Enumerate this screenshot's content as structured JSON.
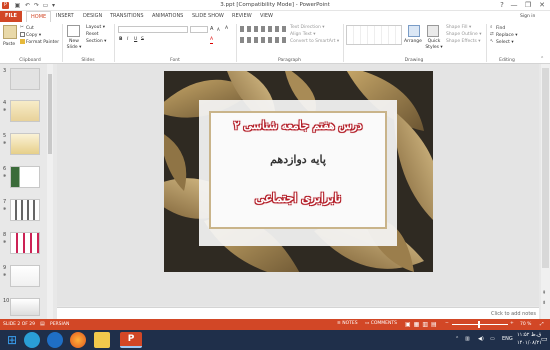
{
  "window": {
    "title": "3.ppt [Compatibility Mode] - PowerPoint",
    "help": "?",
    "minimize": "—",
    "restore": "❐",
    "close": "✕"
  },
  "tabs": [
    "FILE",
    "HOME",
    "INSERT",
    "DESIGN",
    "TRANSITIONS",
    "ANIMATIONS",
    "SLIDE SHOW",
    "REVIEW",
    "VIEW"
  ],
  "account": "Sign in",
  "ribbon": {
    "clipboard": {
      "paste": "Paste",
      "cut": "Cut",
      "copy": "Copy ▾",
      "format_painter": "Format Painter",
      "label": "Clipboard"
    },
    "slides": {
      "new_slide": "New Slide ▾",
      "layout": "Layout ▾",
      "reset": "Reset",
      "section": "Section ▾",
      "label": "Slides"
    },
    "font": {
      "label": "Font",
      "bold": "B",
      "italic": "I",
      "underline": "U",
      "strike": "S",
      "grow": "A",
      "shrink": "A",
      "clear": "A",
      "color": "A"
    },
    "paragraph": {
      "text_direction": "Text Direction ▾",
      "align_text": "Align Text ▾",
      "convert_smartart": "Convert to SmartArt ▾",
      "label": "Paragraph"
    },
    "drawing": {
      "arrange": "Arrange",
      "quick_styles": "Quick Styles ▾",
      "shape_fill": "Shape Fill ▾",
      "shape_outline": "Shape Outline ▾",
      "shape_effects": "Shape Effects ▾",
      "label": "Drawing"
    },
    "editing": {
      "find": "Find",
      "replace": "Replace ▾",
      "select": "Select ▾",
      "label": "Editing"
    }
  },
  "thumbnails": [
    {
      "num": "3"
    },
    {
      "num": "4"
    },
    {
      "num": "5"
    },
    {
      "num": "6"
    },
    {
      "num": "7"
    },
    {
      "num": "8"
    },
    {
      "num": "9"
    },
    {
      "num": "10"
    }
  ],
  "slide": {
    "line1": "درس هفتم جامعه شناسی ۲",
    "line2": "پایه دوازدهم",
    "line3": "نابرابری اجتماعی"
  },
  "notes_placeholder": "Click to add notes",
  "status": {
    "slide_info": "SLIDE 2 OF 29",
    "language": "PERSIAN",
    "notes": "NOTES",
    "comments": "COMMENTS",
    "zoom": "70 %"
  },
  "taskbar": {
    "lang": "ENG",
    "time": "۱۱:۵۲ ق.ظ",
    "date": "۱۴۰۱/۰۸/۲۱"
  },
  "colors": {
    "accent": "#d24726",
    "taskbar": "#1f2f4a",
    "slide_text": "#b4202a"
  }
}
